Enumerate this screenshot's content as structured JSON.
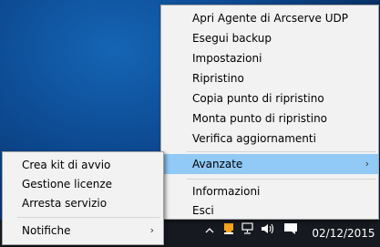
{
  "main_menu": {
    "items": [
      {
        "label": "Apri Agente di Arcserve UDP"
      },
      {
        "label": "Esegui backup"
      },
      {
        "label": "Impostazioni"
      },
      {
        "label": "Ripristino"
      },
      {
        "label": "Copia punto di ripristino"
      },
      {
        "label": "Monta punto di ripristino"
      },
      {
        "label": "Verifica aggiornamenti"
      },
      {
        "label": "Avanzate",
        "submenu_arrow": "›"
      },
      {
        "label": "Informazioni"
      },
      {
        "label": "Esci"
      }
    ]
  },
  "sub_menu": {
    "items": [
      {
        "label": "Crea kit di avvio"
      },
      {
        "label": "Gestione licenze"
      },
      {
        "label": "Arresta servizio"
      },
      {
        "label": "Notifiche",
        "submenu_arrow": "›"
      }
    ]
  },
  "taskbar": {
    "date": "02/12/2015",
    "icons": [
      "chevron-up-icon",
      "arcserve-tray-icon",
      "network-icon",
      "volume-icon",
      "action-center-icon"
    ]
  },
  "colors": {
    "highlight": "#91c9f7",
    "menu_bg": "#f2f2f2",
    "taskbar": "#161a20"
  }
}
